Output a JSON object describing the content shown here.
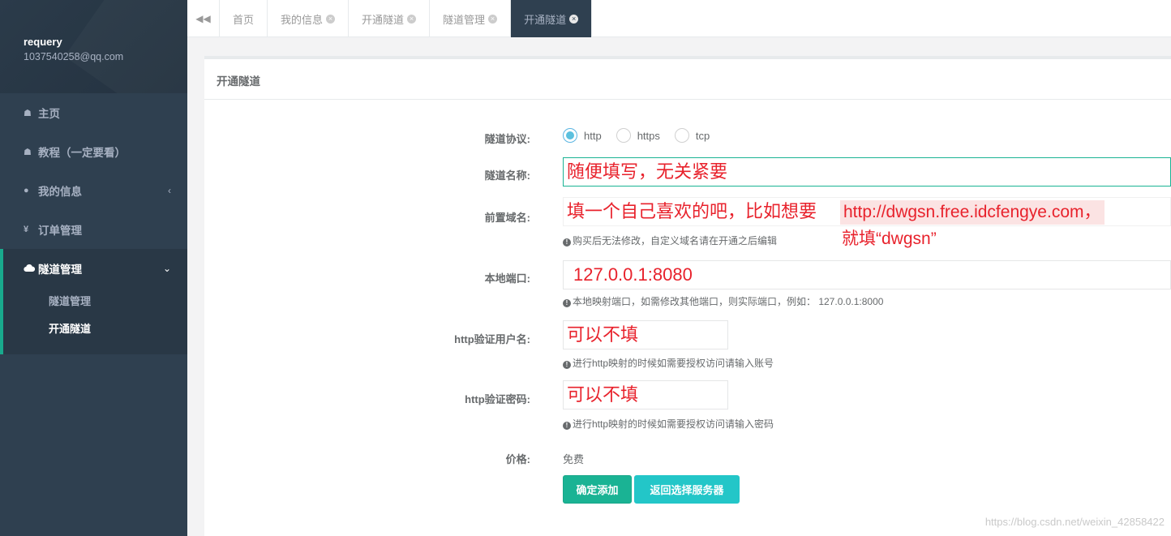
{
  "sidebar": {
    "username": "requery",
    "email": "1037540258@qq.com",
    "items": [
      {
        "label": "主页",
        "icon": "home-icon"
      },
      {
        "label": "教程（一定要看）",
        "icon": "home-icon"
      },
      {
        "label": "我的信息",
        "icon": "user-icon"
      },
      {
        "label": "订单管理",
        "icon": "yen-icon"
      }
    ],
    "group": {
      "label": "隧道管理",
      "icon": "cloud-icon",
      "children": [
        "隧道管理",
        "开通隧道"
      ]
    }
  },
  "tabs": [
    {
      "label": "首页",
      "closable": false
    },
    {
      "label": "我的信息",
      "closable": true
    },
    {
      "label": "开通隧道",
      "closable": true
    },
    {
      "label": "隧道管理",
      "closable": true
    },
    {
      "label": "开通隧道",
      "closable": true,
      "active": true
    }
  ],
  "panel_title": "开通隧道",
  "form": {
    "protocol": {
      "label": "隧道协议:",
      "options": [
        "http",
        "https",
        "tcp"
      ],
      "selected": "http"
    },
    "name": {
      "label": "隧道名称:",
      "annotation": "随便填写，无关紧要"
    },
    "prefix": {
      "label": "前置域名:",
      "annotation": "填一个自己喜欢的吧，比如想要",
      "annotation_line1_tail": "http://dwgsn.free.idcfengye.com，",
      "annotation_line2": "就填“dwgsn”",
      "help": "购买后无法修改，自定义域名请在开通之后编辑"
    },
    "port": {
      "label": "本地端口:",
      "value": "127.0.0.1:8080",
      "help": "本地映射端口，如需修改其他端口，则实际端口，例如： 127.0.0.1:8000"
    },
    "auth_user": {
      "label": "http验证用户名:",
      "annotation": "可以不填",
      "help": "进行http映射的时候如需要授权访问请输入账号"
    },
    "auth_pass": {
      "label": "http验证密码:",
      "annotation": "可以不填",
      "help": "进行http映射的时候如需要授权访问请输入密码"
    },
    "price": {
      "label": "价格:",
      "value": "免费"
    },
    "buttons": {
      "submit": "确定添加",
      "back": "返回选择服务器"
    }
  },
  "watermark": "https://blog.csdn.net/weixin_42858422",
  "colors": {
    "sidebar": "#2f4050",
    "primary": "#1ab394",
    "info": "#23c6c8",
    "annotation": "#e8222c"
  }
}
